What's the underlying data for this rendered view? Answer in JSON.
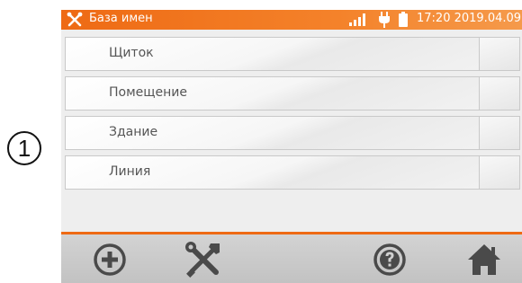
{
  "callout": {
    "number": "1"
  },
  "statusbar": {
    "app_icon": "tools-cross-icon",
    "title": "База имен",
    "icons": [
      "signal-icon",
      "plug-icon",
      "battery-icon"
    ],
    "datetime": "17:20 2019.04.09"
  },
  "list": {
    "items": [
      {
        "label": "Щиток"
      },
      {
        "label": "Помещение"
      },
      {
        "label": "Здание"
      },
      {
        "label": "Линия"
      }
    ]
  },
  "toolbar": {
    "buttons": [
      "add-icon",
      "tools-icon",
      "help-icon",
      "home-icon"
    ]
  },
  "colors": {
    "accent": "#ee6a14",
    "icon": "#4a4a4a",
    "background": "#eeeeee"
  }
}
